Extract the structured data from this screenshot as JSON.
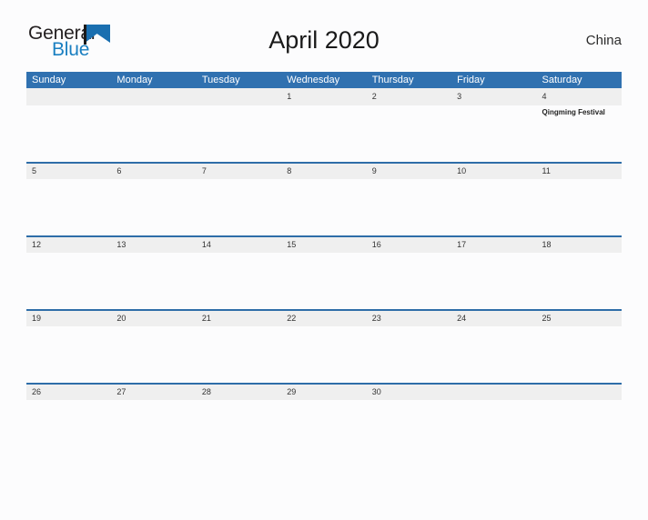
{
  "brand": {
    "word_one": "General",
    "word_two": "Blue",
    "flag_icon": "blue-triangle-flag-icon",
    "color_dark": "#231f20",
    "color_blue": "#1a7fc1"
  },
  "header": {
    "title": "April 2020",
    "region": "China"
  },
  "theme": {
    "header_blue": "#3071b0",
    "band_gray": "#efefef",
    "band_border_blue": "#2e6da8",
    "page_background": "#fcfcfd"
  },
  "calendar": {
    "weekdays": [
      "Sunday",
      "Monday",
      "Tuesday",
      "Wednesday",
      "Thursday",
      "Friday",
      "Saturday"
    ],
    "weeks": [
      {
        "days": [
          {
            "number": "",
            "events": []
          },
          {
            "number": "",
            "events": []
          },
          {
            "number": "",
            "events": []
          },
          {
            "number": "1",
            "events": []
          },
          {
            "number": "2",
            "events": []
          },
          {
            "number": "3",
            "events": []
          },
          {
            "number": "4",
            "events": [
              "Qingming Festival"
            ]
          }
        ]
      },
      {
        "days": [
          {
            "number": "5",
            "events": []
          },
          {
            "number": "6",
            "events": []
          },
          {
            "number": "7",
            "events": []
          },
          {
            "number": "8",
            "events": []
          },
          {
            "number": "9",
            "events": []
          },
          {
            "number": "10",
            "events": []
          },
          {
            "number": "11",
            "events": []
          }
        ]
      },
      {
        "days": [
          {
            "number": "12",
            "events": []
          },
          {
            "number": "13",
            "events": []
          },
          {
            "number": "14",
            "events": []
          },
          {
            "number": "15",
            "events": []
          },
          {
            "number": "16",
            "events": []
          },
          {
            "number": "17",
            "events": []
          },
          {
            "number": "18",
            "events": []
          }
        ]
      },
      {
        "days": [
          {
            "number": "19",
            "events": []
          },
          {
            "number": "20",
            "events": []
          },
          {
            "number": "21",
            "events": []
          },
          {
            "number": "22",
            "events": []
          },
          {
            "number": "23",
            "events": []
          },
          {
            "number": "24",
            "events": []
          },
          {
            "number": "25",
            "events": []
          }
        ]
      },
      {
        "days": [
          {
            "number": "26",
            "events": []
          },
          {
            "number": "27",
            "events": []
          },
          {
            "number": "28",
            "events": []
          },
          {
            "number": "29",
            "events": []
          },
          {
            "number": "30",
            "events": []
          },
          {
            "number": "",
            "events": []
          },
          {
            "number": "",
            "events": []
          }
        ]
      }
    ]
  }
}
